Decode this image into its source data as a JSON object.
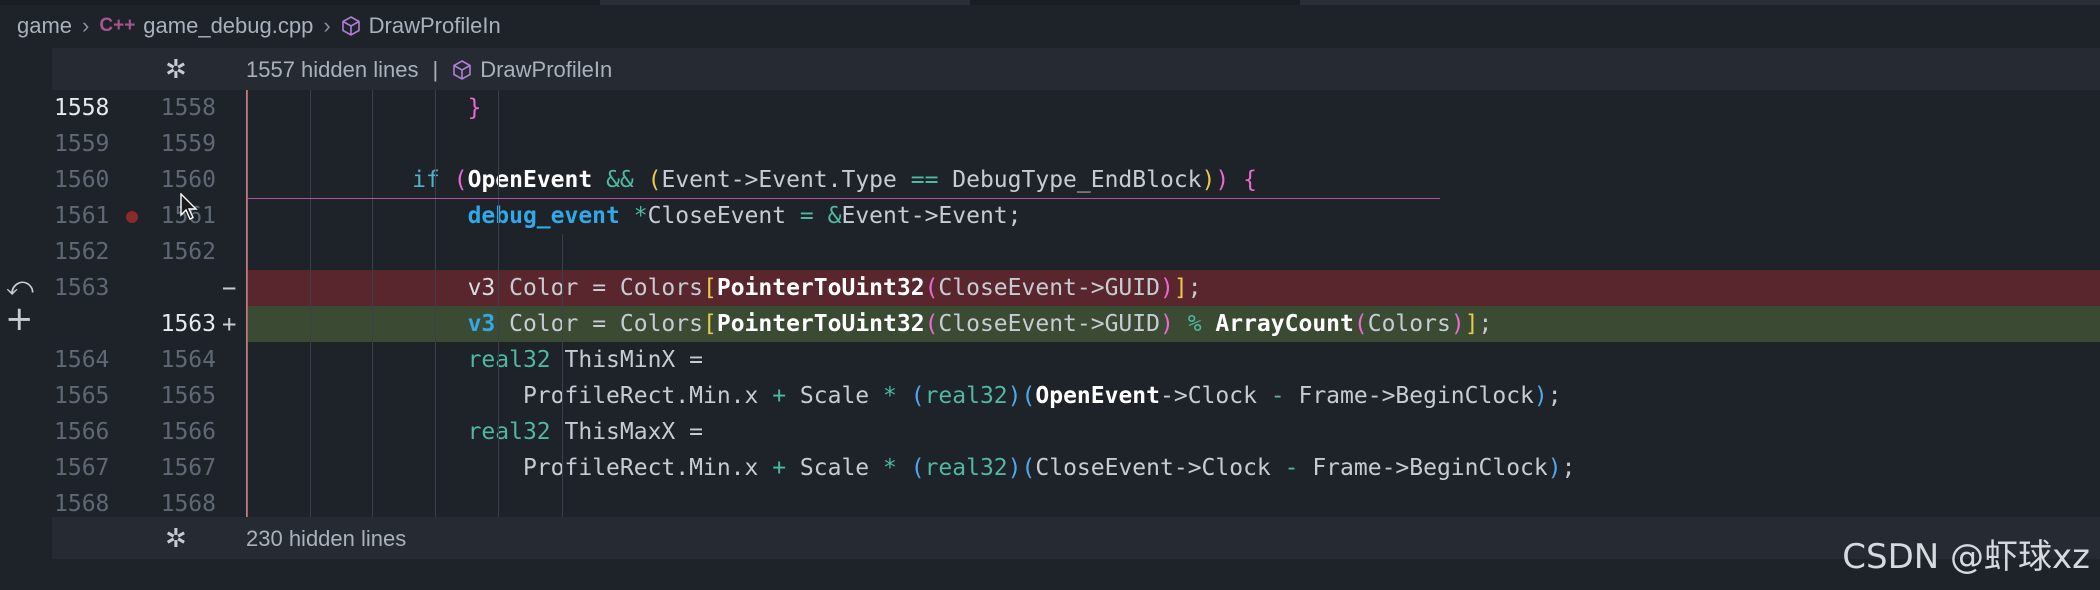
{
  "breadcrumb": {
    "folder": "game",
    "lang_badge": "C++",
    "file": "game_debug.cpp",
    "symbol": "DrawProfileIn"
  },
  "fold_top": {
    "text": "1557 hidden lines",
    "symbol": "DrawProfileIn"
  },
  "fold_bottom": {
    "text": "230 hidden lines"
  },
  "lines": [
    {
      "old": "1558",
      "new": "1558"
    },
    {
      "old": "1559",
      "new": "1559"
    },
    {
      "old": "1560",
      "new": "1560"
    },
    {
      "old": "1561",
      "new": "1561"
    },
    {
      "old": "1562",
      "new": "1562"
    },
    {
      "old": "1563",
      "new": ""
    },
    {
      "old": "",
      "new": "1563"
    },
    {
      "old": "1564",
      "new": "1564"
    },
    {
      "old": "1565",
      "new": "1565"
    },
    {
      "old": "1566",
      "new": "1566"
    },
    {
      "old": "1567",
      "new": "1567"
    },
    {
      "old": "1568",
      "new": "1568"
    }
  ],
  "markers": {
    "removed": "−",
    "added": "+"
  },
  "code": {
    "l1558_brace": "}",
    "l1560_if": "if",
    "l1560_open_paren": "(",
    "l1560_openevent": "OpenEvent",
    "l1560_and": " && ",
    "l1560_inner_open": "(",
    "l1560_event": "Event->Event.Type ",
    "l1560_eq": "==",
    "l1560_endblock": " DebugType_EndBlock",
    "l1560_inner_close": ")",
    "l1560_close_paren": ")",
    "l1560_brace": " {",
    "l1561_type": "debug_event",
    "l1561_star": " *",
    "l1561_rest1": "CloseEvent ",
    "l1561_eq": "=",
    "l1561_amp": " &",
    "l1561_rest2": "Event->Event;",
    "del_v3": "v3",
    "del_color": " Color = Colors",
    "del_br_open": "[",
    "del_fn": "PointerToUint32",
    "del_p_open": "(",
    "del_arg": "CloseEvent->GUID",
    "del_p_close": ")",
    "del_br_close": "]",
    "del_semi": ";",
    "add_v3": "v3",
    "add_color": " Color = Colors",
    "add_br_open": "[",
    "add_fn": "PointerToUint32",
    "add_p_open": "(",
    "add_arg": "CloseEvent->GUID",
    "add_p_close": ")",
    "add_mod": " % ",
    "add_fn2": "ArrayCount",
    "add_p2_open": "(",
    "add_arg2": "Colors",
    "add_p2_close": ")",
    "add_br_close": "]",
    "add_semi": ";",
    "l1564_type": "real32",
    "l1564_rest": " ThisMinX =",
    "l1565_a": "ProfileRect.Min.x ",
    "l1565_plus": "+",
    "l1565_b": " Scale ",
    "l1565_mul": "*",
    "l1565_p1o": " (",
    "l1565_type": "real32",
    "l1565_p1c": ")",
    "l1565_p2o": "(",
    "l1565_open": "OpenEvent",
    "l1565_c": "->Clock ",
    "l1565_minus": "-",
    "l1565_d": " Frame->BeginClock",
    "l1565_p2c": ")",
    "l1565_semi": ";",
    "l1566_type": "real32",
    "l1566_rest": " ThisMaxX =",
    "l1567_a": "ProfileRect.Min.x ",
    "l1567_plus": "+",
    "l1567_b": " Scale ",
    "l1567_mul": "*",
    "l1567_p1o": " (",
    "l1567_type": "real32",
    "l1567_p1c": ")",
    "l1567_p2o": "(",
    "l1567_c": "CloseEvent->Clock ",
    "l1567_minus": "-",
    "l1567_d": " Frame->BeginClock",
    "l1567_p2c": ")",
    "l1567_semi": ";"
  },
  "watermark": "CSDN @虾球xz",
  "colors": {
    "background": "#1e2229",
    "deleted_line": "#5a262d",
    "added_line": "#3a4a33",
    "keyword": "#32a8e6",
    "type": "#4fb8a0",
    "bracket_pink": "#e86ad0",
    "bracket_yellow": "#e8c94a"
  }
}
